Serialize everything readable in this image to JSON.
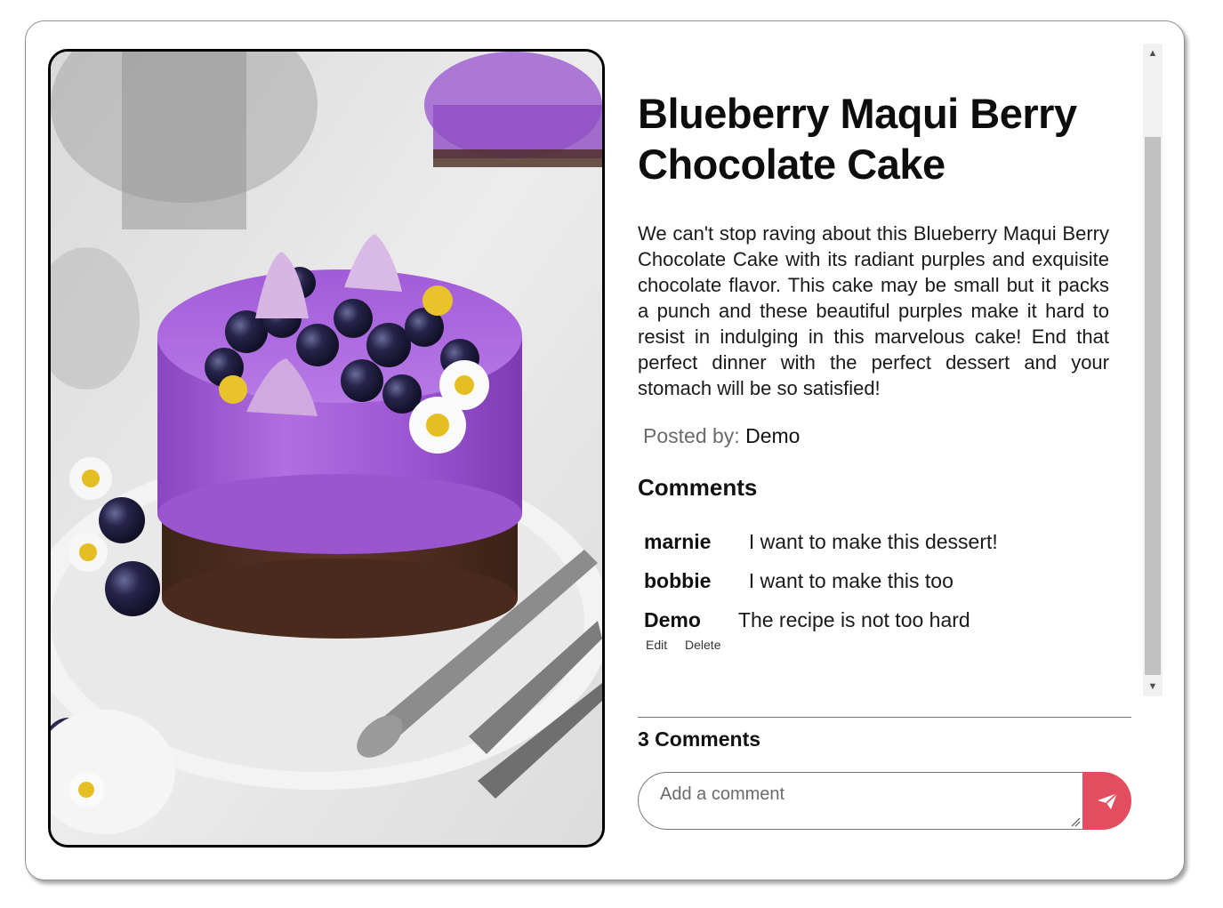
{
  "recipe": {
    "title": "Blueberry Maqui Berry Chocolate Cake",
    "description": "We can't stop raving about this Blueberry Maqui Berry Chocolate Cake with its radiant purples and exquisite chocolate flavor. This cake may be small but it packs a punch and these beautiful purples make it hard to resist in indulging in this marvelous cake! End that perfect dinner with the perfect dessert and your stomach will be so satisfied!",
    "posted_by_label": "Posted by:",
    "posted_by": "Demo",
    "image_icon": "cake-photo"
  },
  "comments": {
    "heading": "Comments",
    "items": [
      {
        "user": "marnie",
        "text": "I want to make this dessert!"
      },
      {
        "user": "bobbie",
        "text": "I want to make this too"
      },
      {
        "user": "Demo",
        "text": "The recipe is not too hard",
        "edit_label": "Edit",
        "delete_label": "Delete"
      }
    ],
    "count_label": "3 Comments"
  },
  "comment_form": {
    "placeholder": "Add a comment",
    "send_icon": "paper-plane-icon"
  },
  "colors": {
    "send_button": "#e44d5f",
    "frame_border": "#000000",
    "cake_purple": "#a05bd0"
  }
}
